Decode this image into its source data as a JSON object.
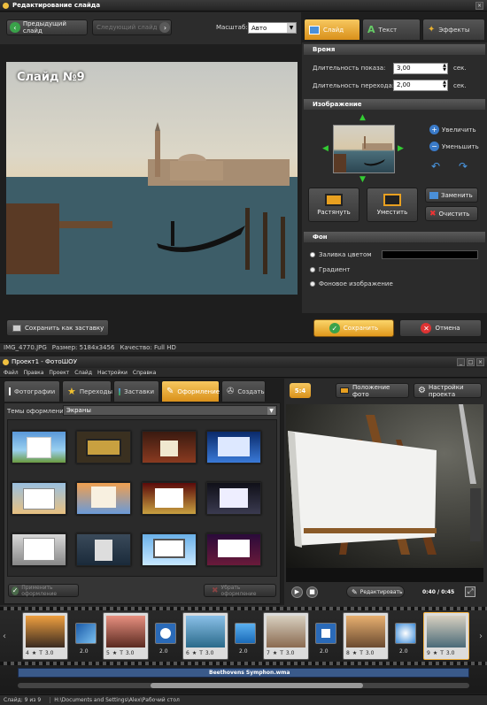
{
  "editor": {
    "title": "Редактирование слайда",
    "prev_label": "Предыдущий слайд",
    "next_label": "Следующий слайд",
    "scale_label": "Масштаб:",
    "scale_value": "Авто",
    "tabs": [
      "Слайд",
      "Текст",
      "Эффекты"
    ],
    "slide_caption": "Слайд №9",
    "save_as_screensaver": "Сохранить как заставку",
    "status": {
      "file": "IMG_4770.JPG",
      "size": "Размер: 5184x3456",
      "quality": "Качество: Full HD"
    },
    "time": {
      "title": "Время",
      "show_label": "Длительность показа:",
      "show_value": "3,00",
      "trans_label": "Длительность перехода:",
      "trans_value": "2,00",
      "unit": "сек."
    },
    "image": {
      "title": "Изображение",
      "zoom_in": "Увеличить",
      "zoom_out": "Уменьшить",
      "stretch": "Растянуть",
      "fit": "Уместить",
      "replace": "Заменить",
      "clear": "Очистить"
    },
    "bg": {
      "title": "Фон",
      "fill": "Заливка цветом",
      "gradient": "Градиент",
      "image": "Фоновое изображение",
      "fill_color": "#000000"
    },
    "save": "Сохранить",
    "cancel": "Отмена"
  },
  "main": {
    "title": "Проект1 - ФотоШОУ",
    "menu": [
      "Файл",
      "Правка",
      "Проект",
      "Слайд",
      "Настройки",
      "Справка"
    ],
    "tabs": [
      "Фотографии",
      "Переходы",
      "Заставки",
      "Оформление",
      "Создать"
    ],
    "themes_label": "Темы оформления:",
    "themes_value": "Экраны",
    "apply": "Применить оформление",
    "remove": "Убрать оформление",
    "aspect": "5:4",
    "photo_position": "Положение фото",
    "project_settings": "Настройки проекта",
    "edit": "Редактировать",
    "time": "0:40 / 0:45",
    "audio": "Beethovens Symphon.wma",
    "timeline": [
      {
        "num": "4",
        "dur": "3.0",
        "trans": "2.0"
      },
      {
        "num": "5",
        "dur": "3.0",
        "trans": "2.0"
      },
      {
        "num": "6",
        "dur": "3.0",
        "trans": "2.0"
      },
      {
        "num": "7",
        "dur": "3.0",
        "trans": "2.0"
      },
      {
        "num": "8",
        "dur": "3.0",
        "trans": "2.0"
      },
      {
        "num": "9",
        "dur": "3.0"
      }
    ],
    "status_slide": "Слайд: 9 из 9",
    "status_path": "H:\\Documents and Settings\\Alex\\Рабочий стол"
  }
}
